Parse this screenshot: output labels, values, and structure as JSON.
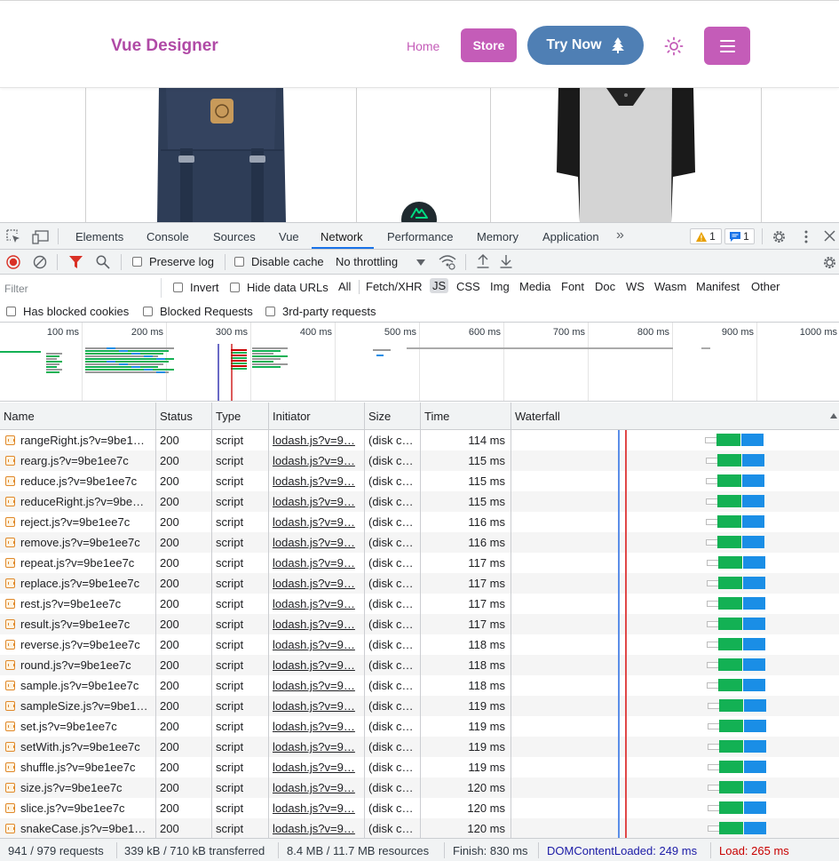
{
  "site": {
    "brand": "Vue Designer",
    "nav_home": "Home",
    "nav_store": "Store",
    "nav_try": "Try Now"
  },
  "devtools": {
    "tabs": [
      "Elements",
      "Console",
      "Sources",
      "Vue",
      "Network",
      "Performance",
      "Memory",
      "Application"
    ],
    "active_tab": "Network",
    "warnings_count": "1",
    "messages_count": "1",
    "toolbar": {
      "preserve_log": "Preserve log",
      "disable_cache": "Disable cache",
      "throttling": "No throttling"
    },
    "filter": {
      "placeholder": "Filter",
      "invert": "Invert",
      "hide_data_urls": "Hide data URLs",
      "types": [
        "All",
        "Fetch/XHR",
        "JS",
        "CSS",
        "Img",
        "Media",
        "Font",
        "Doc",
        "WS",
        "Wasm",
        "Manifest",
        "Other"
      ],
      "active_type": "JS",
      "has_blocked_cookies": "Has blocked cookies",
      "blocked_requests": "Blocked Requests",
      "third_party": "3rd-party requests"
    },
    "overview_ticks": [
      "100 ms",
      "200 ms",
      "300 ms",
      "400 ms",
      "500 ms",
      "600 ms",
      "700 ms",
      "800 ms",
      "900 ms",
      "1000 ms"
    ],
    "columns": [
      "Name",
      "Status",
      "Type",
      "Initiator",
      "Size",
      "Time",
      "Waterfall"
    ],
    "rows": [
      {
        "name": "rangeRight.js?v=9be1…",
        "status": "200",
        "type": "script",
        "initiator": "lodash.js?v=9…",
        "size": "(disk c…",
        "time": "114 ms"
      },
      {
        "name": "rearg.js?v=9be1ee7c",
        "status": "200",
        "type": "script",
        "initiator": "lodash.js?v=9…",
        "size": "(disk c…",
        "time": "115 ms"
      },
      {
        "name": "reduce.js?v=9be1ee7c",
        "status": "200",
        "type": "script",
        "initiator": "lodash.js?v=9…",
        "size": "(disk c…",
        "time": "115 ms"
      },
      {
        "name": "reduceRight.js?v=9be…",
        "status": "200",
        "type": "script",
        "initiator": "lodash.js?v=9…",
        "size": "(disk c…",
        "time": "115 ms"
      },
      {
        "name": "reject.js?v=9be1ee7c",
        "status": "200",
        "type": "script",
        "initiator": "lodash.js?v=9…",
        "size": "(disk c…",
        "time": "116 ms"
      },
      {
        "name": "remove.js?v=9be1ee7c",
        "status": "200",
        "type": "script",
        "initiator": "lodash.js?v=9…",
        "size": "(disk c…",
        "time": "116 ms"
      },
      {
        "name": "repeat.js?v=9be1ee7c",
        "status": "200",
        "type": "script",
        "initiator": "lodash.js?v=9…",
        "size": "(disk c…",
        "time": "117 ms"
      },
      {
        "name": "replace.js?v=9be1ee7c",
        "status": "200",
        "type": "script",
        "initiator": "lodash.js?v=9…",
        "size": "(disk c…",
        "time": "117 ms"
      },
      {
        "name": "rest.js?v=9be1ee7c",
        "status": "200",
        "type": "script",
        "initiator": "lodash.js?v=9…",
        "size": "(disk c…",
        "time": "117 ms"
      },
      {
        "name": "result.js?v=9be1ee7c",
        "status": "200",
        "type": "script",
        "initiator": "lodash.js?v=9…",
        "size": "(disk c…",
        "time": "117 ms"
      },
      {
        "name": "reverse.js?v=9be1ee7c",
        "status": "200",
        "type": "script",
        "initiator": "lodash.js?v=9…",
        "size": "(disk c…",
        "time": "118 ms"
      },
      {
        "name": "round.js?v=9be1ee7c",
        "status": "200",
        "type": "script",
        "initiator": "lodash.js?v=9…",
        "size": "(disk c…",
        "time": "118 ms"
      },
      {
        "name": "sample.js?v=9be1ee7c",
        "status": "200",
        "type": "script",
        "initiator": "lodash.js?v=9…",
        "size": "(disk c…",
        "time": "118 ms"
      },
      {
        "name": "sampleSize.js?v=9be1…",
        "status": "200",
        "type": "script",
        "initiator": "lodash.js?v=9…",
        "size": "(disk c…",
        "time": "119 ms"
      },
      {
        "name": "set.js?v=9be1ee7c",
        "status": "200",
        "type": "script",
        "initiator": "lodash.js?v=9…",
        "size": "(disk c…",
        "time": "119 ms"
      },
      {
        "name": "setWith.js?v=9be1ee7c",
        "status": "200",
        "type": "script",
        "initiator": "lodash.js?v=9…",
        "size": "(disk c…",
        "time": "119 ms"
      },
      {
        "name": "shuffle.js?v=9be1ee7c",
        "status": "200",
        "type": "script",
        "initiator": "lodash.js?v=9…",
        "size": "(disk c…",
        "time": "119 ms"
      },
      {
        "name": "size.js?v=9be1ee7c",
        "status": "200",
        "type": "script",
        "initiator": "lodash.js?v=9…",
        "size": "(disk c…",
        "time": "120 ms"
      },
      {
        "name": "slice.js?v=9be1ee7c",
        "status": "200",
        "type": "script",
        "initiator": "lodash.js?v=9…",
        "size": "(disk c…",
        "time": "120 ms"
      },
      {
        "name": "snakeCase.js?v=9be1…",
        "status": "200",
        "type": "script",
        "initiator": "lodash.js?v=9…",
        "size": "(disk c…",
        "time": "120 ms"
      }
    ],
    "status_bar": {
      "requests": "941 / 979 requests",
      "transferred": "339 kB / 710 kB transferred",
      "resources": "8.4 MB / 11.7 MB resources",
      "finish": "Finish: 830 ms",
      "dom_content_loaded": "DOMContentLoaded: 249 ms",
      "load": "Load: 265 ms"
    }
  },
  "colors": {
    "brand": "#b04aa6",
    "accent_pink": "#c45cb8",
    "accent_blue": "#4f7fb4",
    "dcl_blue": "#1a1aa6",
    "load_red": "#c80000"
  }
}
